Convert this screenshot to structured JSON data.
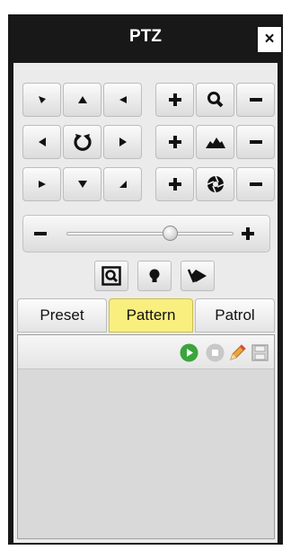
{
  "window": {
    "title": "PTZ",
    "close_label": "×"
  },
  "direction_pad": {
    "buttons": [
      {
        "name": "pan-up-left-button",
        "icon": "arrow-up-left-icon"
      },
      {
        "name": "pan-up-button",
        "icon": "arrow-up-icon"
      },
      {
        "name": "pan-up-right-button",
        "icon": "arrow-up-right-icon"
      },
      {
        "name": "pan-left-button",
        "icon": "arrow-left-icon"
      },
      {
        "name": "auto-scan-button",
        "icon": "rotate-icon"
      },
      {
        "name": "pan-right-button",
        "icon": "arrow-right-icon"
      },
      {
        "name": "pan-down-left-button",
        "icon": "arrow-down-left-icon"
      },
      {
        "name": "pan-down-button",
        "icon": "arrow-down-icon"
      },
      {
        "name": "pan-down-right-button",
        "icon": "arrow-down-right-icon"
      }
    ]
  },
  "lens_controls": [
    {
      "name": "zoom",
      "icon": "magnifier-icon",
      "plus": "+",
      "minus": "−"
    },
    {
      "name": "focus",
      "icon": "mountain-icon",
      "plus": "+",
      "minus": "−"
    },
    {
      "name": "iris",
      "icon": "aperture-icon",
      "plus": "+",
      "minus": "−"
    }
  ],
  "speed_slider": {
    "minus_label": "−",
    "plus_label": "+",
    "value_fraction": 0.62
  },
  "tools": [
    {
      "name": "3d-zoom-button",
      "icon": "zoom-frame-icon"
    },
    {
      "name": "light-button",
      "icon": "light-bulb-icon"
    },
    {
      "name": "wiper-button",
      "icon": "wiper-icon"
    }
  ],
  "tabs": [
    {
      "label": "Preset",
      "active": false
    },
    {
      "label": "Pattern",
      "active": true
    },
    {
      "label": "Patrol",
      "active": false
    }
  ],
  "pattern_toolbar": {
    "icons": [
      "play-icon",
      "stop-icon",
      "edit-pencil-icon",
      "save-disk-icon"
    ]
  },
  "colors": {
    "panel_background": "#181818",
    "active_tab": "#f8ef7f",
    "play_green": "#3aa53a"
  }
}
